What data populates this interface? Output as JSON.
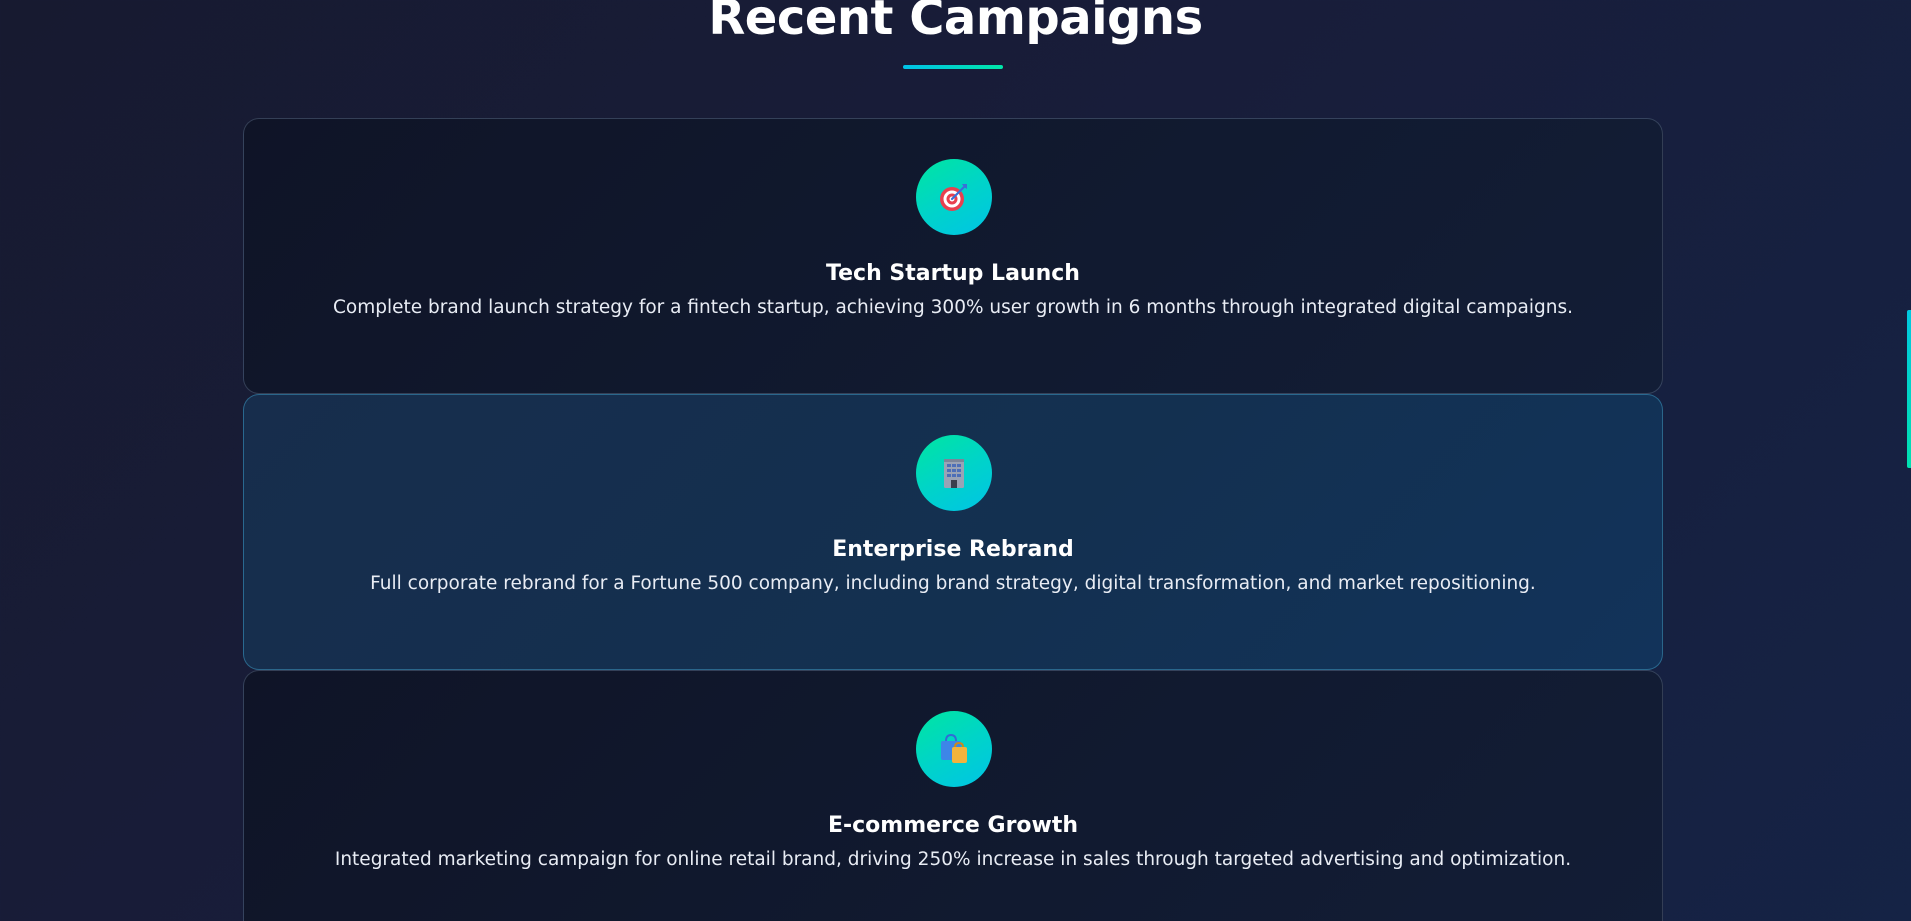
{
  "section": {
    "title": "Recent Campaigns"
  },
  "colors": {
    "accent_gradient_start": "#00e6a0",
    "accent_gradient_end": "#00c4e6",
    "card_background": "#0f1427",
    "card_active_background": "#133050"
  },
  "campaigns": [
    {
      "icon": "target-icon",
      "title": "Tech Startup Launch",
      "description": "Complete brand launch strategy for a fintech startup, achieving 300% user growth in 6 months through integrated digital campaigns.",
      "active": false
    },
    {
      "icon": "office-building-icon",
      "title": "Enterprise Rebrand",
      "description": "Full corporate rebrand for a Fortune 500 company, including brand strategy, digital transformation, and market repositioning.",
      "active": true
    },
    {
      "icon": "shopping-bags-icon",
      "title": "E-commerce Growth",
      "description": "Integrated marketing campaign for online retail brand, driving 250% increase in sales through targeted advertising and optimization.",
      "active": false
    }
  ]
}
